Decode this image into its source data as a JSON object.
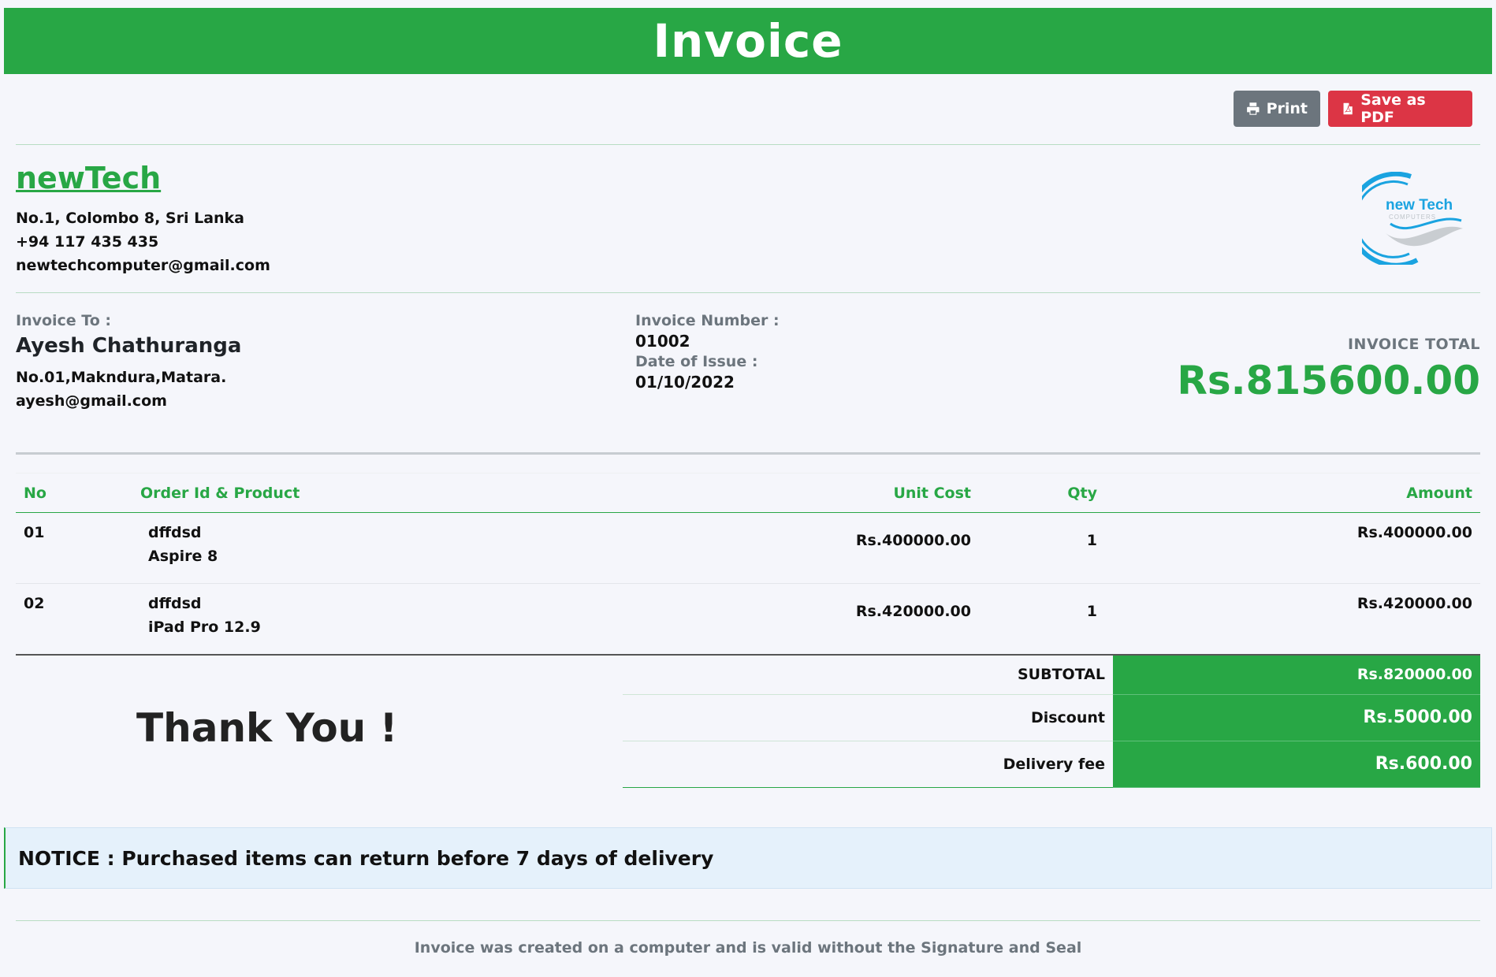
{
  "header": {
    "title": "Invoice"
  },
  "actions": {
    "print_label": "Print",
    "pdf_label": "Save as PDF"
  },
  "company": {
    "name": "newTech",
    "address": "No.1, Colombo 8, Sri Lanka",
    "phone": "+94 117 435 435",
    "email": "newtechcomputer@gmail.com",
    "logo_text_main": "new Tech",
    "logo_text_sub": "COMPUTERS"
  },
  "invoice_to": {
    "label": "Invoice To :",
    "name": "Ayesh Chathuranga",
    "address": "No.01,Makndura,Matara.",
    "email": "ayesh@gmail.com"
  },
  "invoice_meta": {
    "number_label": "Invoice Number :",
    "number": "01002",
    "date_label": "Date of Issue :",
    "date": "01/10/2022"
  },
  "invoice_total": {
    "label": "INVOICE TOTAL",
    "amount": "Rs.815600.00"
  },
  "items_table": {
    "headers": {
      "no": "No",
      "product": "Order Id & Product",
      "unit_cost": "Unit Cost",
      "qty": "Qty",
      "amount": "Amount"
    },
    "rows": [
      {
        "no": "01",
        "order_id": "dffdsd",
        "product": "Aspire 8",
        "unit_cost": "Rs.400000.00",
        "qty": "1",
        "amount": "Rs.400000.00"
      },
      {
        "no": "02",
        "order_id": "dffdsd",
        "product": "iPad Pro 12.9",
        "unit_cost": "Rs.420000.00",
        "qty": "1",
        "amount": "Rs.420000.00"
      }
    ]
  },
  "thanks": "Thank You !",
  "totals": {
    "subtotal_label": "SUBTOTAL",
    "subtotal": "Rs.820000.00",
    "discount_label": "Discount",
    "discount": "Rs.5000.00",
    "delivery_label": "Delivery fee",
    "delivery": "Rs.600.00"
  },
  "notice": "NOTICE : Purchased items can return before 7 days of delivery",
  "footer": "Invoice was created on a computer and is valid without the Signature and Seal",
  "colors": {
    "accent": "#28a745",
    "danger": "#dc3545",
    "secondary": "#6c757d",
    "logo_blue": "#1aa3e0"
  },
  "icons": {
    "print": "printer-icon",
    "pdf": "file-pdf-icon"
  }
}
